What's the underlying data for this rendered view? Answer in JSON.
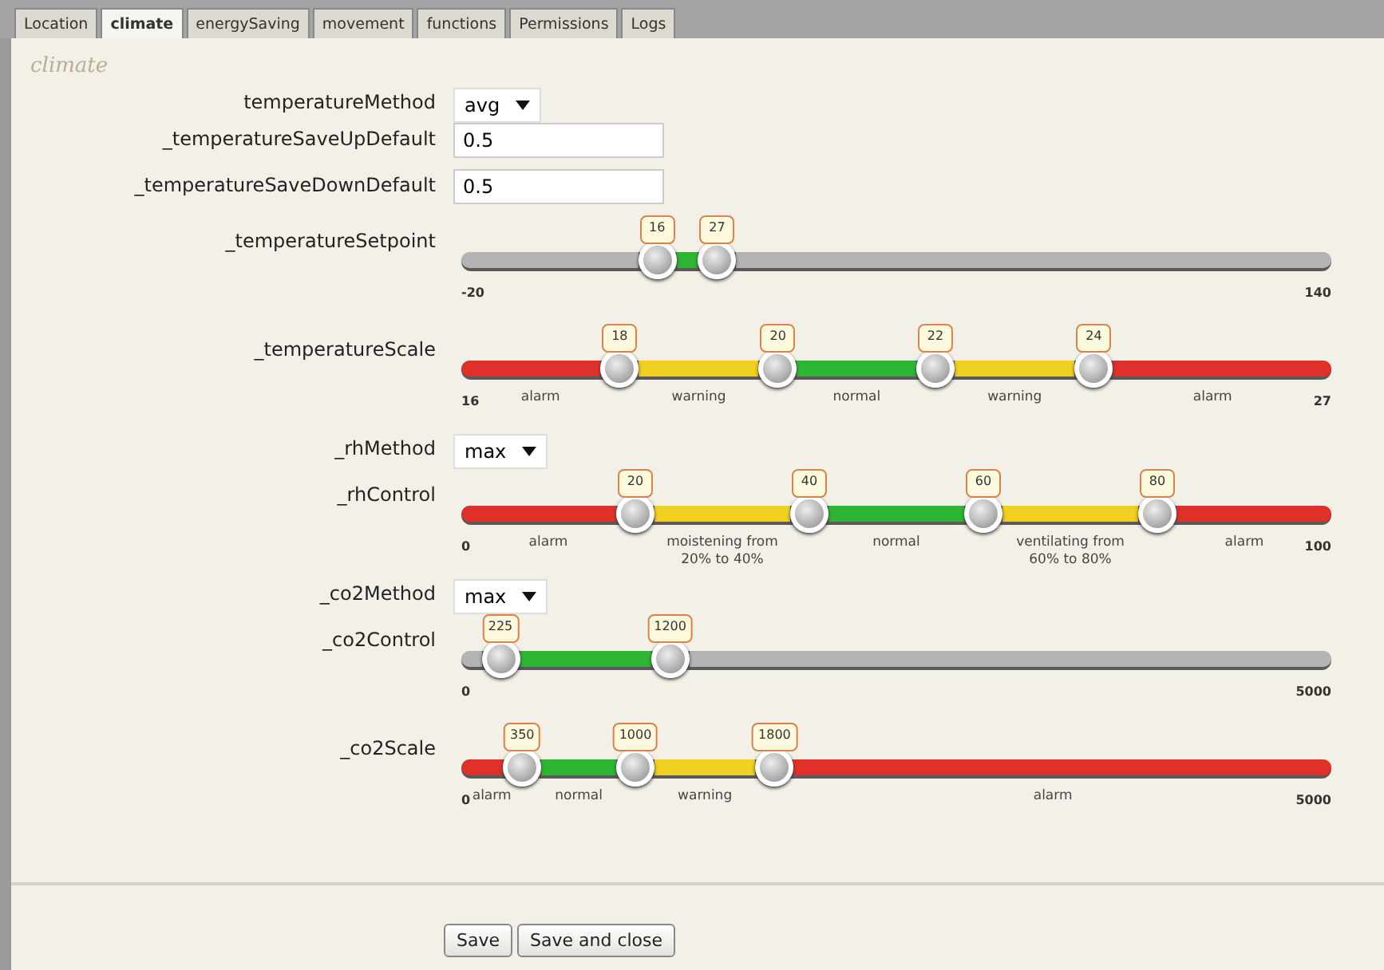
{
  "tabs": [
    {
      "label": "Location",
      "selected": false
    },
    {
      "label": "climate",
      "selected": true
    },
    {
      "label": "energySaving",
      "selected": false
    },
    {
      "label": "movement",
      "selected": false
    },
    {
      "label": "functions",
      "selected": false
    },
    {
      "label": "Permissions",
      "selected": false
    },
    {
      "label": "Logs",
      "selected": false
    }
  ],
  "section_title": "climate",
  "fields": [
    {
      "kind": "select",
      "label": "temperatureMethod",
      "value": "avg"
    },
    {
      "kind": "text",
      "label": "_temperatureSaveUpDefault",
      "value": "0.5"
    },
    {
      "kind": "text",
      "label": "_temperatureSaveDownDefault",
      "value": "0.5"
    },
    {
      "kind": "slider",
      "label": "_temperatureSetpoint",
      "min_label": "-20",
      "max_label": "140",
      "handles": [
        {
          "value": "16",
          "level": 0.225
        },
        {
          "value": "27",
          "level": 0.294
        }
      ],
      "segments": [
        {
          "color": "#b4b4b4"
        },
        {
          "color": "#2fb534"
        },
        {
          "color": "#b4b4b4"
        }
      ]
    },
    {
      "kind": "slider",
      "label": "_temperatureScale",
      "min_label": "16",
      "max_label": "27",
      "handles": [
        {
          "value": "18",
          "level": 0.182
        },
        {
          "value": "20",
          "level": 0.364
        },
        {
          "value": "22",
          "level": 0.545
        },
        {
          "value": "24",
          "level": 0.727
        }
      ],
      "segments": [
        {
          "color": "#e0302a",
          "label": "alarm"
        },
        {
          "color": "#f0d020",
          "label": "warning"
        },
        {
          "color": "#2fb534",
          "label": "normal"
        },
        {
          "color": "#f0d020",
          "label": "warning"
        },
        {
          "color": "#e0302a",
          "label": "alarm"
        }
      ]
    },
    {
      "kind": "select",
      "label": "_rhMethod",
      "value": "max"
    },
    {
      "kind": "slider",
      "label": "_rhControl",
      "min_label": "0",
      "max_label": "100",
      "handles": [
        {
          "value": "20",
          "level": 0.2
        },
        {
          "value": "40",
          "level": 0.4
        },
        {
          "value": "60",
          "level": 0.6
        },
        {
          "value": "80",
          "level": 0.8
        }
      ],
      "segments": [
        {
          "color": "#e0302a",
          "label": "alarm"
        },
        {
          "color": "#f0d020",
          "label": "moistening from 20% to 40%"
        },
        {
          "color": "#2fb534",
          "label": "normal"
        },
        {
          "color": "#f0d020",
          "label": "ventilating from 60% to 80%"
        },
        {
          "color": "#e0302a",
          "label": "alarm"
        }
      ]
    },
    {
      "kind": "select",
      "label": "_co2Method",
      "value": "max"
    },
    {
      "kind": "slider",
      "label": "_co2Control",
      "min_label": "0",
      "max_label": "5000",
      "handles": [
        {
          "value": "225",
          "level": 0.045
        },
        {
          "value": "1200",
          "level": 0.24
        }
      ],
      "segments": [
        {
          "color": "#b4b4b4"
        },
        {
          "color": "#2fb534"
        },
        {
          "color": "#b4b4b4"
        }
      ]
    },
    {
      "kind": "slider",
      "label": "_co2Scale",
      "min_label": "0",
      "max_label": "5000",
      "handles": [
        {
          "value": "350",
          "level": 0.07
        },
        {
          "value": "1000",
          "level": 0.2
        },
        {
          "value": "1800",
          "level": 0.36
        }
      ],
      "segments": [
        {
          "color": "#e0302a",
          "label": "alarm"
        },
        {
          "color": "#2fb534",
          "label": "normal"
        },
        {
          "color": "#f0d020",
          "label": "warning"
        },
        {
          "color": "#e0302a",
          "label": "alarm"
        }
      ]
    }
  ],
  "buttons": [
    "Save",
    "Save and close"
  ]
}
